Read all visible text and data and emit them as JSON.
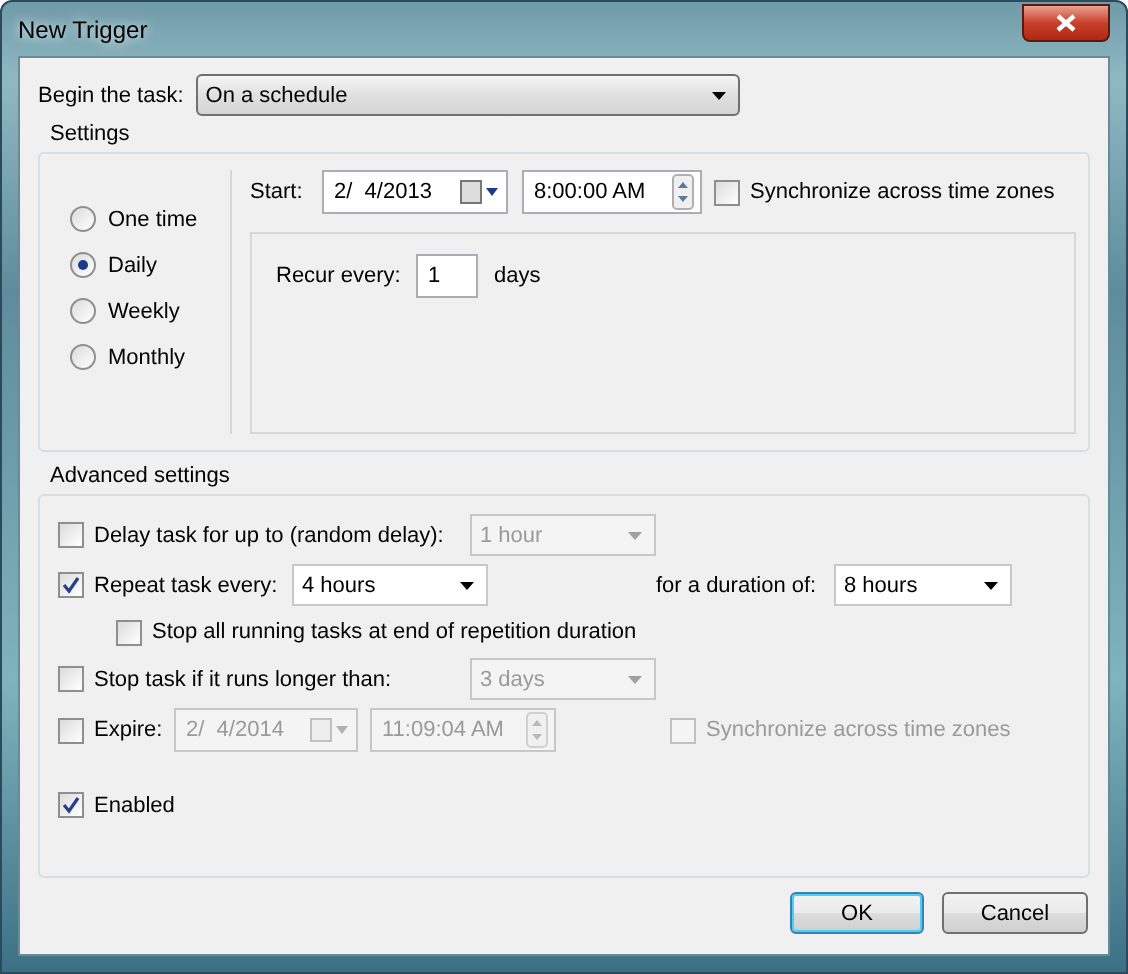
{
  "window": {
    "title": "New Trigger"
  },
  "begin": {
    "label": "Begin the task:",
    "value": "On a schedule"
  },
  "settings": {
    "title": "Settings",
    "schedules": [
      {
        "label": "One time",
        "selected": false
      },
      {
        "label": "Daily",
        "selected": true
      },
      {
        "label": "Weekly",
        "selected": false
      },
      {
        "label": "Monthly",
        "selected": false
      }
    ],
    "start": {
      "label": "Start:",
      "date": "2/  4/2013",
      "time": "8:00:00 AM"
    },
    "sync": {
      "label": "Synchronize across time zones",
      "checked": false
    },
    "recur": {
      "label": "Recur every:",
      "value": "1",
      "unit": "days"
    }
  },
  "advanced": {
    "title": "Advanced settings",
    "delay": {
      "label": "Delay task for up to (random delay):",
      "checked": false,
      "value": "1 hour",
      "disabled": true
    },
    "repeat": {
      "label": "Repeat task every:",
      "checked": true,
      "value": "4 hours",
      "disabled": false,
      "duration_label": "for a duration of:",
      "duration": "8 hours"
    },
    "stop_all": {
      "label": "Stop all running tasks at end of repetition duration",
      "checked": false
    },
    "stop_task": {
      "label": "Stop task if it runs longer than:",
      "checked": false,
      "value": "3 days",
      "disabled": true
    },
    "expire": {
      "label": "Expire:",
      "checked": false,
      "date": "2/  4/2014",
      "time": "11:09:04 AM",
      "disabled": true
    },
    "expire_sync": {
      "label": "Synchronize across time zones",
      "checked": false,
      "disabled": true
    },
    "enabled": {
      "label": "Enabled",
      "checked": true
    }
  },
  "buttons": [
    {
      "label": "OK",
      "default": true
    },
    {
      "label": "Cancel",
      "default": false
    }
  ]
}
